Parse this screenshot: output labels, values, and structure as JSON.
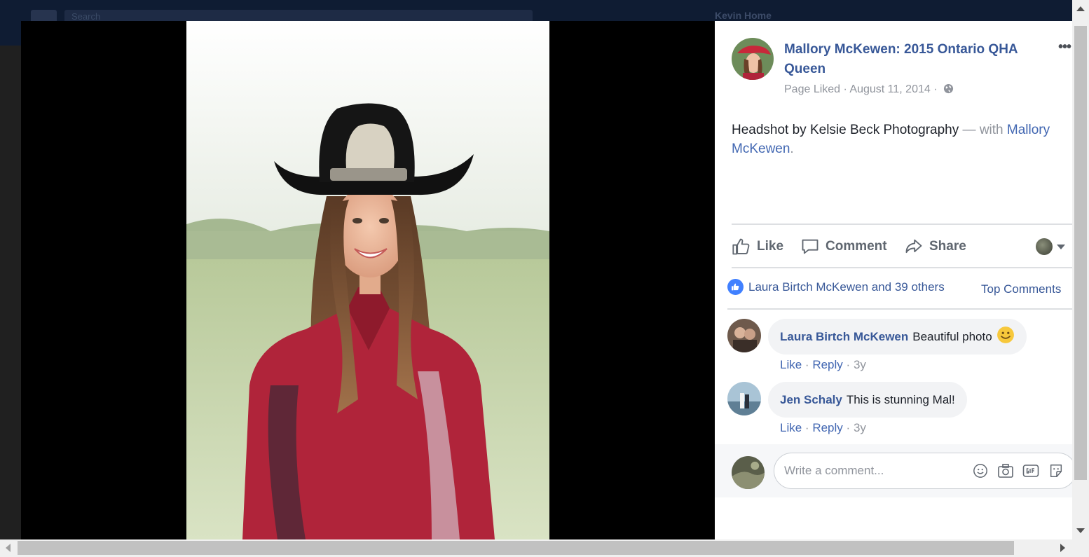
{
  "background_page": {
    "search_placeholder": "Search",
    "user_name": "Kevin Home"
  },
  "post": {
    "page_name": "Mallory McKewen: 2015 Ontario QHA Queen",
    "more_label": "•••",
    "status": "Page Liked",
    "separator": "·",
    "date": "August 11, 2014",
    "privacy_icon": "globe-icon",
    "caption_text": "Headshot by Kelsie Beck Photography",
    "caption_with": " — with ",
    "caption_tag": "Mallory McKewen",
    "caption_end": "."
  },
  "actions": {
    "like": "Like",
    "comment": "Comment",
    "share": "Share"
  },
  "reactions": {
    "summary": "Laura Birtch McKewen and 39 others",
    "sort_label": "Top Comments"
  },
  "comments": [
    {
      "author": "Laura Birtch McKewen",
      "text": "Beautiful photo",
      "emoji": "smiley-emoji",
      "like": "Like",
      "reply": "Reply",
      "sep": "·",
      "age": "3y"
    },
    {
      "author": "Jen Schaly",
      "text": "This is stunning Mal!",
      "like": "Like",
      "reply": "Reply",
      "sep": "·",
      "age": "3y"
    }
  ],
  "composer": {
    "placeholder": "Write a comment...",
    "icons": [
      "emoji-icon",
      "camera-icon",
      "gif-icon",
      "sticker-icon"
    ]
  },
  "colors": {
    "link": "#385898",
    "muted": "#90949c",
    "like_blue": "#4080ff",
    "topbar": "#0f1c33"
  }
}
